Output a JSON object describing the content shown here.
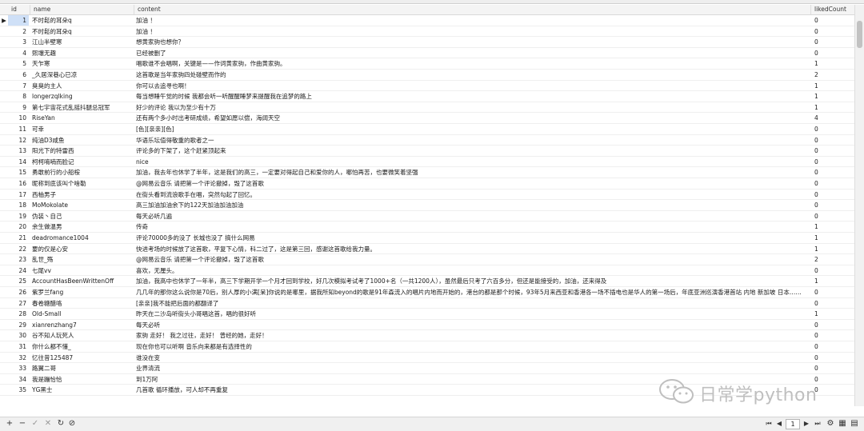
{
  "columns": {
    "id": "id",
    "name": "name",
    "content": "content",
    "likedCount": "likedCount"
  },
  "rows": [
    {
      "id": "1",
      "name": "不时鬆的耳朵q",
      "content": "加油 ！",
      "liked": "0"
    },
    {
      "id": "2",
      "name": "不时鬆的耳朵q",
      "content": "加油 ！",
      "liked": "0"
    },
    {
      "id": "3",
      "name": "江山半壁寒",
      "content": "想黄家驹也想你？",
      "liked": "0"
    },
    {
      "id": "4",
      "name": "熙壤无趣",
      "content": "已经被删了",
      "liked": "0"
    },
    {
      "id": "5",
      "name": "天乍寒",
      "content": "唱歌谁不会唱啊，关键是——作词黄家驹，作曲黄家驹。",
      "liked": "1"
    },
    {
      "id": "6",
      "name": "_久居深巷心已凉",
      "content": "这首歌是当年家驹四处碰壁而作的",
      "liked": "2"
    },
    {
      "id": "7",
      "name": "臭臭的主人",
      "content": "你可以去追寻也啊！",
      "liked": "1"
    },
    {
      "id": "8",
      "name": "longerzqlking",
      "content": "每当想睡午觉的时候 我都会听一听醒醒睡梦来提醒我在追梦的路上",
      "liked": "1"
    },
    {
      "id": "9",
      "name": "第七宇宙花式乱摇抖腿总冠军",
      "content": "好少的评论 我以为至少有十万",
      "liked": "1"
    },
    {
      "id": "10",
      "name": "RiseYan",
      "content": "还有两个多小时出考研成绩，希望如愿以偿，海阔天空",
      "liked": "4"
    },
    {
      "id": "11",
      "name": "可幸",
      "content": "[色][亲亲][色]",
      "liked": "0"
    },
    {
      "id": "12",
      "name": "纯油D3咸鱼",
      "content": "华语乐坛值得敬重的歌者之一",
      "liked": "0"
    },
    {
      "id": "13",
      "name": "阳光下的特雷西",
      "content": "评论多的下架了，这个赶紧顶起来",
      "liked": "0"
    },
    {
      "id": "14",
      "name": "柯柯唷喃而脸记",
      "content": "nice",
      "liked": "0"
    },
    {
      "id": "15",
      "name": "勇敢前行的小船桉",
      "content": "加油，我去年也休学了半年，这是我们的高三，一定要对得起自己和爱你的人，哪怕再苦，也要微笑着坚强",
      "liked": "0"
    },
    {
      "id": "16",
      "name": "昵称到底该叫个啥勒",
      "content": "@网易云音乐 请把第一个评论撤掉，毁了这首歌",
      "liked": "0"
    },
    {
      "id": "17",
      "name": "西柚男子",
      "content": "在街头看到流浪歌手在唱，突然勾起了回忆。",
      "liked": "0"
    },
    {
      "id": "18",
      "name": "MoMokolate",
      "content": "高三加油加油余下的122天加油加油加油",
      "liked": "0"
    },
    {
      "id": "19",
      "name": "伪装丶自己",
      "content": "每天必听几遍",
      "liked": "0"
    },
    {
      "id": "20",
      "name": "余生做温男",
      "content": "传奇",
      "liked": "1"
    },
    {
      "id": "21",
      "name": "deadromance1004",
      "content": "评论70000多的没了 长城也没了 搞什么网易",
      "liked": "1"
    },
    {
      "id": "22",
      "name": "要的仅是心安",
      "content": "快进考场的时候放了这首歌，平复下心情，科二过了，这是第三回，感谢这首歌给我力量。",
      "liked": "1"
    },
    {
      "id": "23",
      "name": "乱世_殇",
      "content": "@网易云音乐 请把第一个评论撤掉，毁了这首歌",
      "liked": "2"
    },
    {
      "id": "24",
      "name": "七尾vv",
      "content": "喜欢，无厘头。",
      "liked": "0"
    },
    {
      "id": "25",
      "name": "AccountHasBeenWrittenOff",
      "content": "加油，我高中也休学了一年半，高三下学期开学一个月才回到学校，好几次模拟考试考了1000+名（一共1200人），虽然最后只考了六百多分，但还是能接受的，加油，还来得及",
      "liked": "1"
    },
    {
      "id": "26",
      "name": "紫罗兰fang",
      "content": "几几年的那你这么说你是70后，别人厚的小满[呆]你说的是哪里，据我所知beyond的歌是91年森流入的唱片内地而开始的，港台的都是那个时候，93年5月来西亚和香港各一场不插电也是华人的第一场后，年底亚洲巡演香港首站 内地 新加坡 日本……",
      "liked": "0"
    },
    {
      "id": "27",
      "name": "春卷糖醋咯",
      "content": "[亲亲]我不能把后面的都翻译了",
      "liked": "0"
    },
    {
      "id": "28",
      "name": "Old-Small",
      "content": "昨天在二沙岛听街头小哥唱这首，唱的很好听",
      "liked": "1"
    },
    {
      "id": "29",
      "name": "xianrenzhang7",
      "content": "每天必听",
      "liked": "0"
    },
    {
      "id": "30",
      "name": "谷不知人玩死人",
      "content": "家驹 走好！ 我之过往，走好！ 曾经的她，走好！",
      "liked": "0"
    },
    {
      "id": "31",
      "name": "你什么都不懂_",
      "content": "现在你也可以听啊 音乐向来都是有选择性的",
      "liked": "0"
    },
    {
      "id": "32",
      "name": "忆往昔125487",
      "content": "谁没在变",
      "liked": "0"
    },
    {
      "id": "33",
      "name": "路翼二哥",
      "content": "业界清流",
      "liked": "0"
    },
    {
      "id": "34",
      "name": "我是蹦恰恰",
      "content": "到1万阿",
      "liked": "0"
    },
    {
      "id": "35",
      "name": "YG黑士",
      "content": "几首歌 循环播放，可人却不再重复",
      "liked": "0"
    }
  ],
  "pager": {
    "page": "1"
  },
  "watermark": {
    "text": "日常学python",
    "icon": "wechat-icon"
  },
  "icons": {
    "row_indicator": "row-pointer-icon",
    "statusbar_left": [
      "add-icon",
      "remove-icon",
      "confirm-icon",
      "cancel-icon",
      "refresh-icon",
      "stop-icon"
    ],
    "statusbar_right": [
      "first-page-icon",
      "prev-page-icon",
      "next-page-icon",
      "last-page-icon",
      "settings-icon",
      "grid-icon",
      "form-icon"
    ]
  },
  "colors": {
    "selected": "#cfe0f7",
    "header_bg": "#f4f4f4",
    "watermark": "#bfbfbf"
  }
}
